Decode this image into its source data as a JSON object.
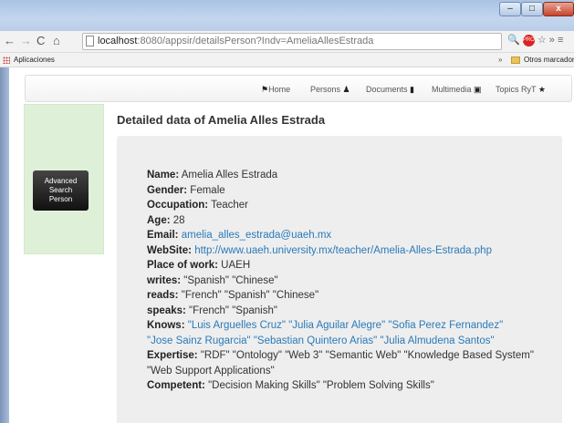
{
  "window": {
    "controls": {
      "minimize": "‒",
      "maximize": "□",
      "close": "x"
    }
  },
  "toolbar": {
    "back_icon": "←",
    "forward_icon": "→",
    "reload_icon": "C",
    "home_icon": "⌂",
    "url_host": "localhost",
    "url_path": ":8080/appsir/detailsPerson?Indv=AmeliaAllesEstrada",
    "right_icons": {
      "search": "🔍",
      "extension": "PRO",
      "star": "☆",
      "more": "»",
      "menu": "≡"
    }
  },
  "bookmarks": {
    "apps_label": "Aplicaciones",
    "more": "»",
    "others_label": "Otros marcadores"
  },
  "navbar": {
    "home": "Home",
    "persons": "Persons",
    "documents": "Documents",
    "multimedia": "Multimedia",
    "topics": "Topics RyT"
  },
  "sidebar": {
    "advanced_button": [
      "Advanced",
      "Search",
      "Person"
    ]
  },
  "detail": {
    "title": "Detailed data of Amelia Alles Estrada",
    "name_label": "Name:",
    "name": "Amelia Alles Estrada",
    "gender_label": "Gender:",
    "gender": "Female",
    "occupation_label": "Occupation:",
    "occupation": "Teacher",
    "age_label": "Age:",
    "age": "28",
    "email_label": "Email:",
    "email": "amelia_alles_estrada@uaeh.mx",
    "website_label": "WebSite:",
    "website": "http://www.uaeh.university.mx/teacher/Amelia-Alles-Estrada.php",
    "work_label": "Place of work:",
    "work": "UAEH",
    "writes_label": "writes:",
    "writes": "\"Spanish\" \"Chinese\"",
    "reads_label": "reads:",
    "reads": "\"French\" \"Spanish\" \"Chinese\"",
    "speaks_label": "speaks:",
    "speaks": "\"French\" \"Spanish\"",
    "knows_label": "Knows:",
    "knows": [
      "\"Luis Arguelles Cruz\"",
      "\"Julia Aguilar Alegre\"",
      "\"Sofia Perez Fernandez\"",
      "\"Jose Sainz Rugarcia\"",
      "\"Sebastian Quintero Arias\"",
      "\"Julia Almudena Santos\""
    ],
    "expertise_label": "Expertise:",
    "expertise": "\"RDF\" \"Ontology\" \"Web 3\" \"Semantic Web\" \"Knowledge Based System\" \"Web Support Applications\"",
    "competent_label": "Competent:",
    "competent": "\"Decision Making Skills\" \"Problem Solving Skills\""
  },
  "colors": {
    "link": "#2a7ab8",
    "sidebar_bg": "#dff0d8",
    "panel_bg": "#eeeeee"
  }
}
